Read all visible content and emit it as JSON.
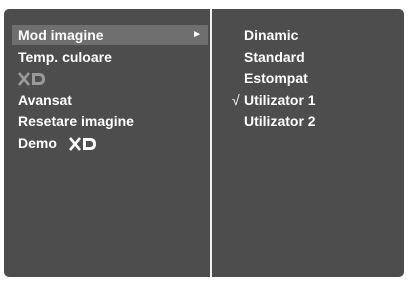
{
  "menu": {
    "items": [
      {
        "label": "Mod imagine",
        "selected": true,
        "arrow": "►"
      },
      {
        "label": "Temp. culoare"
      },
      {
        "label": "XD",
        "logo": "xd-logo-dimmed"
      },
      {
        "label": "Avansat"
      },
      {
        "label": "Resetare imagine"
      },
      {
        "label": "Demo",
        "logo": "xd-logo"
      }
    ]
  },
  "submenu": {
    "check_mark": "√",
    "options": [
      {
        "label": "Dinamic"
      },
      {
        "label": "Standard"
      },
      {
        "label": "Estompat"
      },
      {
        "label": "Utilizator 1",
        "checked": true
      },
      {
        "label": "Utilizator 2"
      }
    ]
  },
  "colors": {
    "background": "#4d4d4d",
    "highlight": "#6f6f6f",
    "text": "#ffffff",
    "divider": "#f0f0f0"
  }
}
